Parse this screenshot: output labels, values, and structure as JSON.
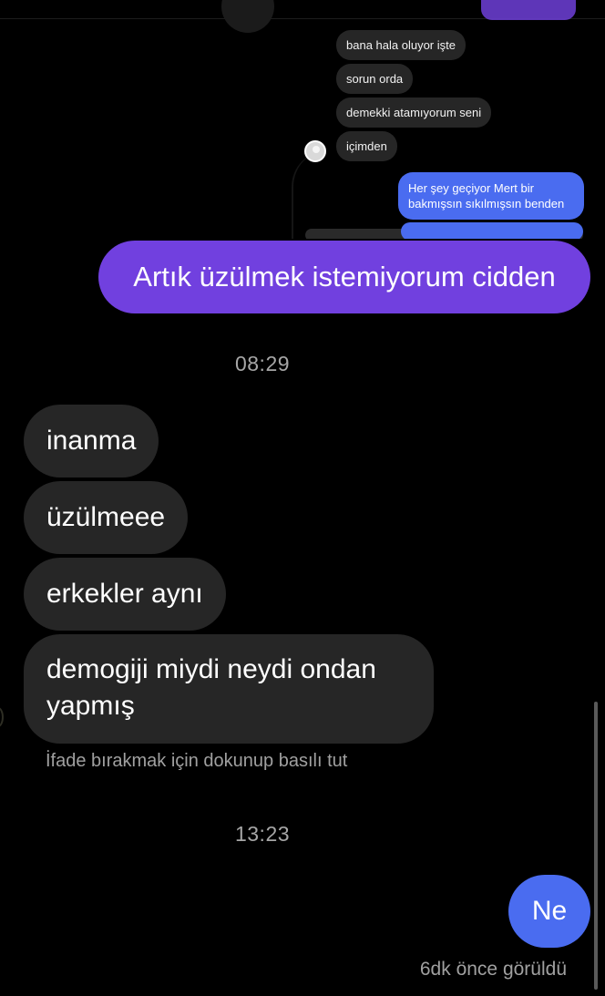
{
  "embedded_chat": {
    "received": [
      "bana  hala oluyor işte",
      "sorun orda",
      "demekki atamıyorum seni",
      "içimden"
    ],
    "sent": "Her şey geçiyor Mert bir bakmışsın sıkılmışsın benden"
  },
  "messages": {
    "sent_top": "Artık üzülmek istemiyorum cidden",
    "time_1": "08:29",
    "received": [
      "inanma",
      "üzülmeee",
      "erkekler aynı",
      "demogiji miydi neydi ondan\nyapmış"
    ],
    "reaction_hint": "İfade bırakmak için dokunup basılı tut",
    "time_2": "13:23",
    "sent_bottom": "Ne",
    "seen_status": "6dk önce görüldü"
  },
  "colors": {
    "background": "#000000",
    "received_bubble": "#262626",
    "sent_purple": "#7140df",
    "sent_blue": "#4a6cf0",
    "meta_text": "#a6a6a6"
  }
}
